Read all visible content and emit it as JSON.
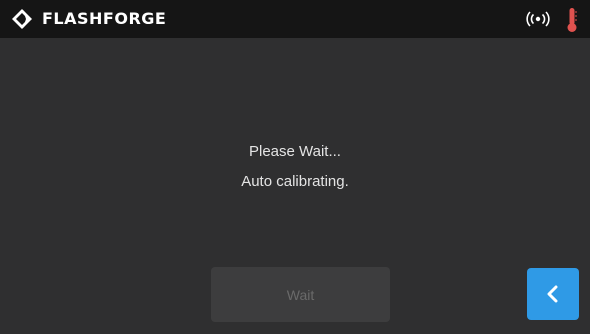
{
  "header": {
    "brand": "FLASHFORGE",
    "logo_icon": "flashforge-logo-icon",
    "wifi_icon": "wifi-signal-icon",
    "temperature_icon": "thermometer-icon",
    "temperature_color": "#e0524f"
  },
  "main": {
    "line1": "Please Wait...",
    "line2": "Auto calibrating."
  },
  "buttons": {
    "wait_label": "Wait",
    "back_icon": "chevron-left-icon",
    "accent_color": "#2f9ae6"
  }
}
